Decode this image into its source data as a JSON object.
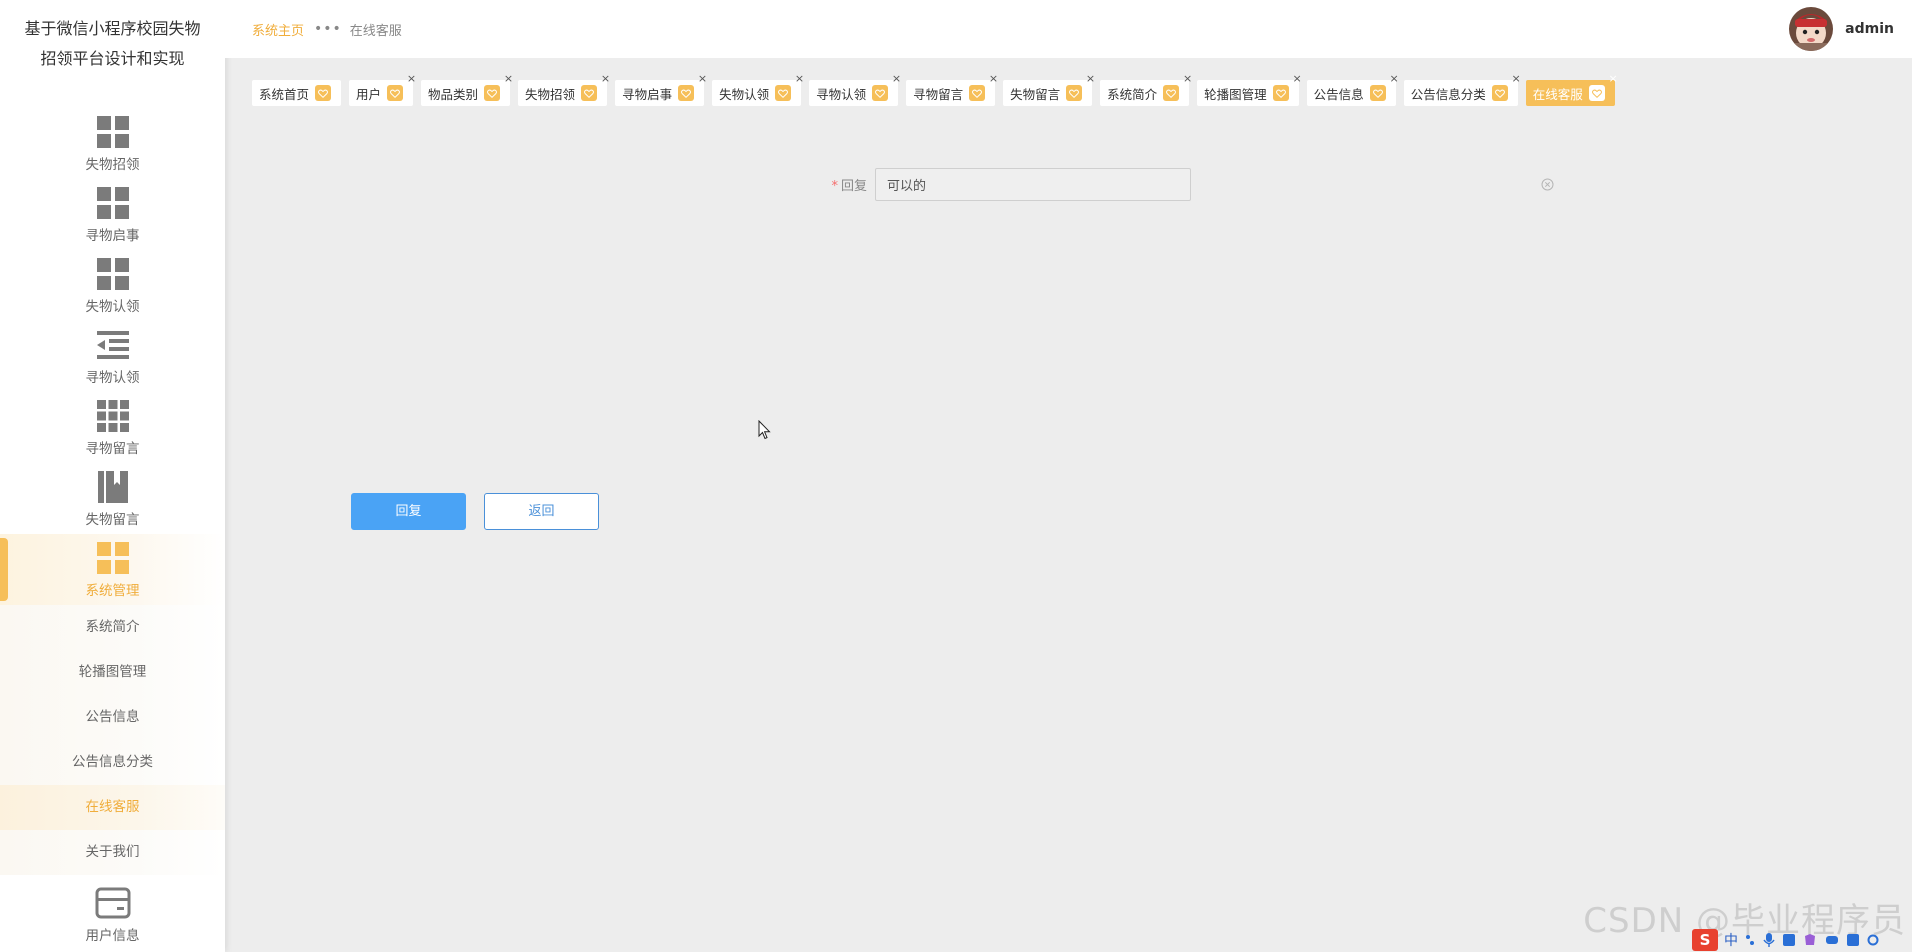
{
  "app": {
    "title_line1": "基于微信小程序校园失物",
    "title_line2": "招领平台设计和实现"
  },
  "sidebar": {
    "items": [
      {
        "label": "失物招领",
        "icon": "grid-icon"
      },
      {
        "label": "寻物启事",
        "icon": "grid-icon"
      },
      {
        "label": "失物认领",
        "icon": "grid-icon"
      },
      {
        "label": "寻物认领",
        "icon": "list-indent-icon"
      },
      {
        "label": "寻物留言",
        "icon": "grid-nine-icon"
      },
      {
        "label": "失物留言",
        "icon": "book-icon"
      },
      {
        "label": "系统管理",
        "icon": "grid-icon",
        "active": true
      }
    ],
    "sub_items": [
      {
        "label": "系统简介"
      },
      {
        "label": "轮播图管理"
      },
      {
        "label": "公告信息"
      },
      {
        "label": "公告信息分类"
      },
      {
        "label": "在线客服",
        "active": true
      },
      {
        "label": "关于我们"
      }
    ],
    "user_info": {
      "label": "用户信息",
      "icon": "card-icon"
    }
  },
  "header": {
    "breadcrumb_home": "系统主页",
    "breadcrumb_sep": "•••",
    "breadcrumb_current": "在线客服",
    "username": "admin"
  },
  "tabs": [
    {
      "label": "系统首页",
      "closable": false
    },
    {
      "label": "用户",
      "closable": true
    },
    {
      "label": "物品类别",
      "closable": true
    },
    {
      "label": "失物招领",
      "closable": true
    },
    {
      "label": "寻物启事",
      "closable": true
    },
    {
      "label": "失物认领",
      "closable": true
    },
    {
      "label": "寻物认领",
      "closable": true
    },
    {
      "label": "寻物留言",
      "closable": true
    },
    {
      "label": "失物留言",
      "closable": true
    },
    {
      "label": "系统简介",
      "closable": true
    },
    {
      "label": "轮播图管理",
      "closable": true
    },
    {
      "label": "公告信息",
      "closable": true
    },
    {
      "label": "公告信息分类",
      "closable": true
    },
    {
      "label": "在线客服",
      "closable": true,
      "active": true
    }
  ],
  "tab_close_glyph": "×",
  "form": {
    "required_mark": "*",
    "reply_label": "回复",
    "reply_value": "可以的"
  },
  "buttons": {
    "submit": "回复",
    "back": "返回"
  },
  "watermark": "CSDN @毕业程序员",
  "tray": {
    "s_label": "S",
    "lang": "中"
  },
  "colors": {
    "accent": "#f6bf59",
    "accent_text": "#f0ad3b",
    "primary_button": "#4aa3f5",
    "background": "#ededed"
  }
}
